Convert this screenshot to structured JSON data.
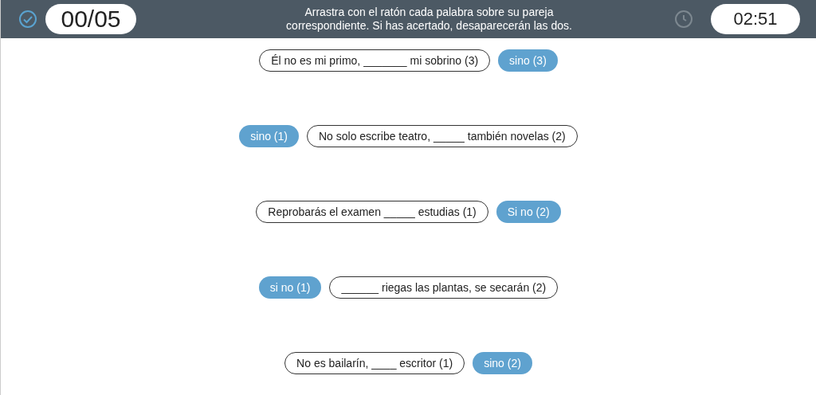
{
  "header": {
    "score": "00/05",
    "instructions": "Arrastra con el ratón cada palabra sobre su pareja correspondiente. Si has acertado, desaparecerán las dos.",
    "timer": "02:51"
  },
  "rows": [
    {
      "items": [
        {
          "kind": "sentence",
          "text": "Él no es mi primo, _______ mi sobrino (3)"
        },
        {
          "kind": "word",
          "text": "sino (3)"
        }
      ]
    },
    {
      "items": [
        {
          "kind": "word",
          "text": "sino (1)"
        },
        {
          "kind": "sentence",
          "text": "No solo escribe teatro, _____ también novelas (2)"
        }
      ]
    },
    {
      "items": [
        {
          "kind": "sentence",
          "text": "Reprobarás el examen _____ estudias (1)"
        },
        {
          "kind": "word",
          "text": "Si no (2)"
        }
      ]
    },
    {
      "items": [
        {
          "kind": "word",
          "text": "si no (1)"
        },
        {
          "kind": "sentence",
          "text": "______ riegas las plantas, se secarán (2)"
        }
      ]
    },
    {
      "items": [
        {
          "kind": "sentence",
          "text": "No es bailarín, ____ escritor (1)"
        },
        {
          "kind": "word",
          "text": "sino (2)"
        }
      ]
    }
  ]
}
